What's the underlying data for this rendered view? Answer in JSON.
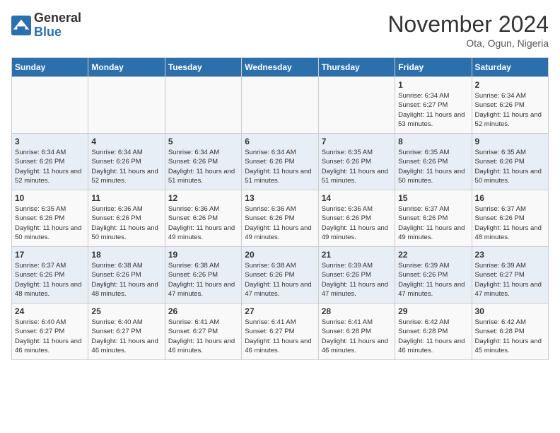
{
  "header": {
    "logo_general": "General",
    "logo_blue": "Blue",
    "title": "November 2024",
    "location": "Ota, Ogun, Nigeria"
  },
  "days_of_week": [
    "Sunday",
    "Monday",
    "Tuesday",
    "Wednesday",
    "Thursday",
    "Friday",
    "Saturday"
  ],
  "weeks": [
    [
      {
        "day": "",
        "info": ""
      },
      {
        "day": "",
        "info": ""
      },
      {
        "day": "",
        "info": ""
      },
      {
        "day": "",
        "info": ""
      },
      {
        "day": "",
        "info": ""
      },
      {
        "day": "1",
        "info": "Sunrise: 6:34 AM\nSunset: 6:27 PM\nDaylight: 11 hours and 53 minutes."
      },
      {
        "day": "2",
        "info": "Sunrise: 6:34 AM\nSunset: 6:26 PM\nDaylight: 11 hours and 52 minutes."
      }
    ],
    [
      {
        "day": "3",
        "info": "Sunrise: 6:34 AM\nSunset: 6:26 PM\nDaylight: 11 hours and 52 minutes."
      },
      {
        "day": "4",
        "info": "Sunrise: 6:34 AM\nSunset: 6:26 PM\nDaylight: 11 hours and 52 minutes."
      },
      {
        "day": "5",
        "info": "Sunrise: 6:34 AM\nSunset: 6:26 PM\nDaylight: 11 hours and 51 minutes."
      },
      {
        "day": "6",
        "info": "Sunrise: 6:34 AM\nSunset: 6:26 PM\nDaylight: 11 hours and 51 minutes."
      },
      {
        "day": "7",
        "info": "Sunrise: 6:35 AM\nSunset: 6:26 PM\nDaylight: 11 hours and 51 minutes."
      },
      {
        "day": "8",
        "info": "Sunrise: 6:35 AM\nSunset: 6:26 PM\nDaylight: 11 hours and 50 minutes."
      },
      {
        "day": "9",
        "info": "Sunrise: 6:35 AM\nSunset: 6:26 PM\nDaylight: 11 hours and 50 minutes."
      }
    ],
    [
      {
        "day": "10",
        "info": "Sunrise: 6:35 AM\nSunset: 6:26 PM\nDaylight: 11 hours and 50 minutes."
      },
      {
        "day": "11",
        "info": "Sunrise: 6:36 AM\nSunset: 6:26 PM\nDaylight: 11 hours and 50 minutes."
      },
      {
        "day": "12",
        "info": "Sunrise: 6:36 AM\nSunset: 6:26 PM\nDaylight: 11 hours and 49 minutes."
      },
      {
        "day": "13",
        "info": "Sunrise: 6:36 AM\nSunset: 6:26 PM\nDaylight: 11 hours and 49 minutes."
      },
      {
        "day": "14",
        "info": "Sunrise: 6:36 AM\nSunset: 6:26 PM\nDaylight: 11 hours and 49 minutes."
      },
      {
        "day": "15",
        "info": "Sunrise: 6:37 AM\nSunset: 6:26 PM\nDaylight: 11 hours and 49 minutes."
      },
      {
        "day": "16",
        "info": "Sunrise: 6:37 AM\nSunset: 6:26 PM\nDaylight: 11 hours and 48 minutes."
      }
    ],
    [
      {
        "day": "17",
        "info": "Sunrise: 6:37 AM\nSunset: 6:26 PM\nDaylight: 11 hours and 48 minutes."
      },
      {
        "day": "18",
        "info": "Sunrise: 6:38 AM\nSunset: 6:26 PM\nDaylight: 11 hours and 48 minutes."
      },
      {
        "day": "19",
        "info": "Sunrise: 6:38 AM\nSunset: 6:26 PM\nDaylight: 11 hours and 47 minutes."
      },
      {
        "day": "20",
        "info": "Sunrise: 6:38 AM\nSunset: 6:26 PM\nDaylight: 11 hours and 47 minutes."
      },
      {
        "day": "21",
        "info": "Sunrise: 6:39 AM\nSunset: 6:26 PM\nDaylight: 11 hours and 47 minutes."
      },
      {
        "day": "22",
        "info": "Sunrise: 6:39 AM\nSunset: 6:26 PM\nDaylight: 11 hours and 47 minutes."
      },
      {
        "day": "23",
        "info": "Sunrise: 6:39 AM\nSunset: 6:27 PM\nDaylight: 11 hours and 47 minutes."
      }
    ],
    [
      {
        "day": "24",
        "info": "Sunrise: 6:40 AM\nSunset: 6:27 PM\nDaylight: 11 hours and 46 minutes."
      },
      {
        "day": "25",
        "info": "Sunrise: 6:40 AM\nSunset: 6:27 PM\nDaylight: 11 hours and 46 minutes."
      },
      {
        "day": "26",
        "info": "Sunrise: 6:41 AM\nSunset: 6:27 PM\nDaylight: 11 hours and 46 minutes."
      },
      {
        "day": "27",
        "info": "Sunrise: 6:41 AM\nSunset: 6:27 PM\nDaylight: 11 hours and 46 minutes."
      },
      {
        "day": "28",
        "info": "Sunrise: 6:41 AM\nSunset: 6:28 PM\nDaylight: 11 hours and 46 minutes."
      },
      {
        "day": "29",
        "info": "Sunrise: 6:42 AM\nSunset: 6:28 PM\nDaylight: 11 hours and 46 minutes."
      },
      {
        "day": "30",
        "info": "Sunrise: 6:42 AM\nSunset: 6:28 PM\nDaylight: 11 hours and 45 minutes."
      }
    ]
  ]
}
